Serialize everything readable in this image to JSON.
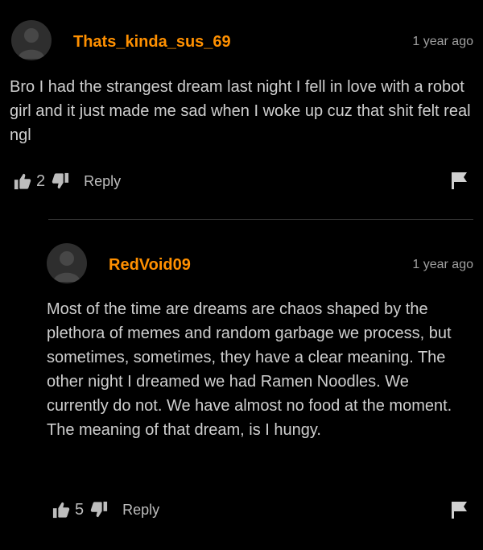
{
  "comments": [
    {
      "username": "Thats_kinda_sus_69",
      "time": "1 year ago",
      "text": "Bro I had the strangest dream last night I fell in love with a robot girl and it just made me sad when I woke up cuz that shit felt real ngl",
      "likes": "2",
      "reply_label": "Reply",
      "avatar_icon": "user-avatar-icon",
      "like_icon": "thumbs-up-icon",
      "dislike_icon": "thumbs-down-icon",
      "flag_icon": "flag-icon"
    },
    {
      "username": "RedVoid09",
      "time": "1 year ago",
      "text": "Most of the time are dreams are chaos shaped by the plethora of memes and random garbage we process, but sometimes, sometimes, they have a clear meaning. The other night I dreamed we had Ramen Noodles. We currently do not. We have almost no food at the moment. The meaning of that dream, is I hungy.",
      "likes": "5",
      "reply_label": "Reply",
      "avatar_icon": "user-avatar-icon",
      "like_icon": "thumbs-up-icon",
      "dislike_icon": "thumbs-down-icon",
      "flag_icon": "flag-icon"
    }
  ],
  "colors": {
    "background": "#000000",
    "username": "#ff9000",
    "text": "#cfcfcf",
    "muted": "#a0a0a0",
    "avatar": "#2e2e2e"
  }
}
